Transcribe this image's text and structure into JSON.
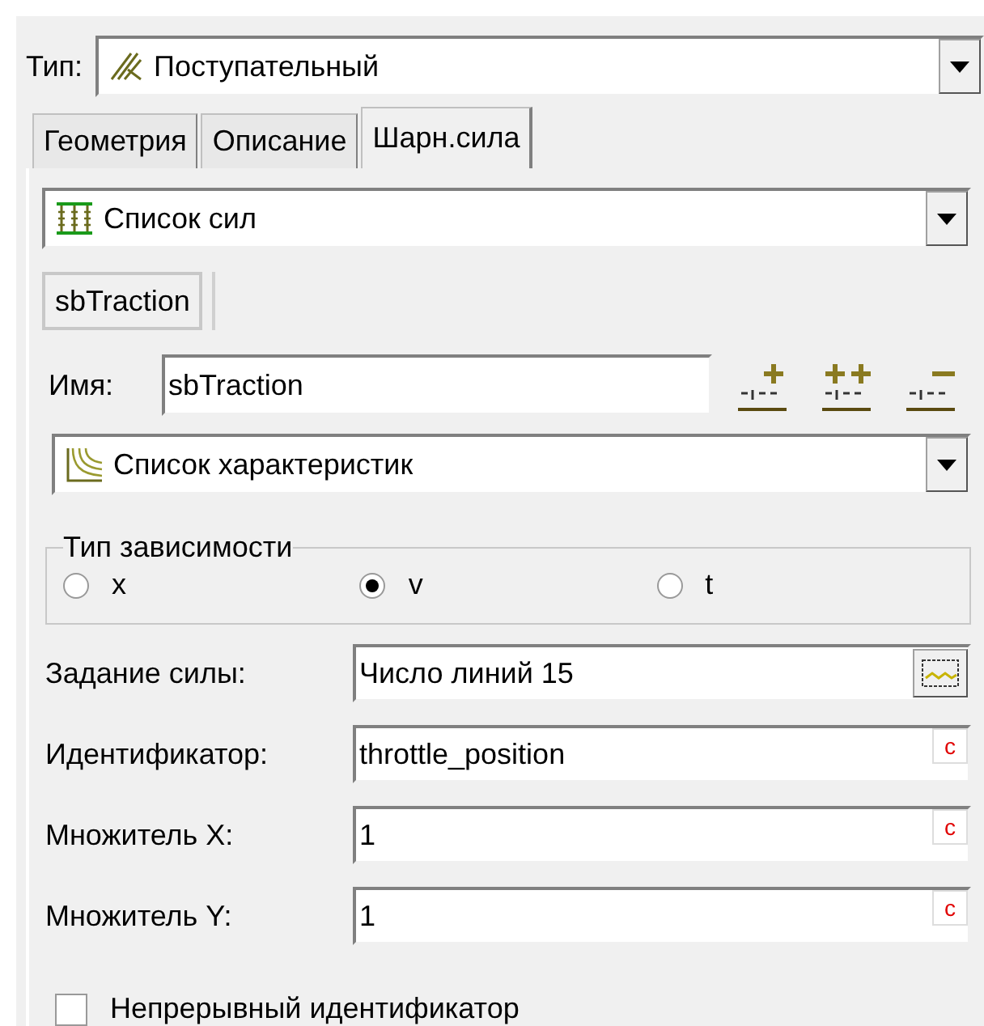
{
  "type_field": {
    "label": "Тип:",
    "value": "Поступательный"
  },
  "tabs": [
    {
      "label": "Геометрия",
      "selected": false
    },
    {
      "label": "Описание",
      "selected": false
    },
    {
      "label": "Шарн.сила",
      "selected": true
    }
  ],
  "force_list": {
    "value": "Список сил"
  },
  "force_tabs": [
    {
      "label": "sbTraction",
      "selected": true
    }
  ],
  "name_field": {
    "label": "Имя:",
    "value": "sbTraction"
  },
  "characteristics": {
    "value": "Список характеристик"
  },
  "dependency_group": {
    "title": "Тип зависимости",
    "options": [
      {
        "label": "x",
        "selected": false
      },
      {
        "label": "v",
        "selected": true
      },
      {
        "label": "t",
        "selected": false
      }
    ]
  },
  "fields": [
    {
      "label": "Задание силы:",
      "value": "Число линий 15",
      "kind": "chart"
    },
    {
      "label": "Идентификатор:",
      "value": "throttle_position",
      "kind": "const",
      "button": "c"
    },
    {
      "label": "Множитель X:",
      "value": "1",
      "kind": "const",
      "button": "c"
    },
    {
      "label": "Множитель Y:",
      "value": "1",
      "kind": "const",
      "button": "c"
    }
  ],
  "continuous": {
    "label": "Непрерывный идентификатор",
    "checked": false
  }
}
